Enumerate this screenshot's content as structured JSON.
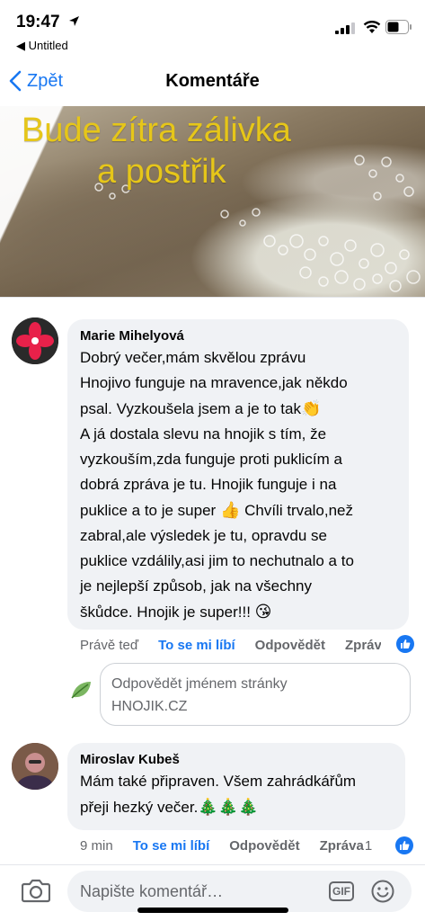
{
  "status_bar": {
    "time": "19:47",
    "back_app": "◀ Untitled"
  },
  "nav": {
    "back_label": "Zpět",
    "title": "Komentáře"
  },
  "post_image": {
    "line1": "Bude zítra zálivka",
    "line2": "a postřik"
  },
  "comments": [
    {
      "author": "Marie Mihelyová",
      "lines": [
        "Dobrý večer,mám skvělou zprávu",
        "Hnojivo funguje na mravence,jak někdo",
        "psal. Vyzkoušela jsem a je to tak",
        "A já dostala slevu na hnojik s tím, že",
        "vyzkouším,zda funguje proti puklicím a",
        "dobrá zpráva je tu. Hnojik funguje i na",
        "puklice a to je super",
        "zabral,ale výsledek je tu, opravdu se",
        "puklice vzdálily,asi jim to nechutnalo a to",
        "je nejlepší způsob, jak na všechny",
        "škůdce. Hnojik je super!!!"
      ],
      "line7_tail": " Chvíli trvalo,než",
      "emoji_clap": "👏",
      "emoji_thumb": "👍",
      "emoji_kiss": "😘",
      "time": "Právě teď",
      "like_label": "To se mi líbí",
      "reply_label": "Odpovědět",
      "share_label": "Zpráva"
    },
    {
      "author": "Miroslav Kubeš",
      "lines": [
        "Mám také připraven. Všem zahrádkářům",
        "přeji hezký večer."
      ],
      "emoji_wreaths": "🎄🎄🎄",
      "time": "9 min",
      "like_label": "To se mi líbí",
      "reply_label": "Odpovědět",
      "share_label": "Zpráva",
      "like_count": "1"
    }
  ],
  "reply_box": {
    "line1": "Odpovědět jménem stránky",
    "line2": "HNOJIK.CZ"
  },
  "composer": {
    "placeholder": "Napište komentář…",
    "gif_label": "GIF"
  },
  "colors": {
    "accent": "#1877f2",
    "bubble": "#f0f2f5",
    "overlay_text": "#e6c619"
  }
}
